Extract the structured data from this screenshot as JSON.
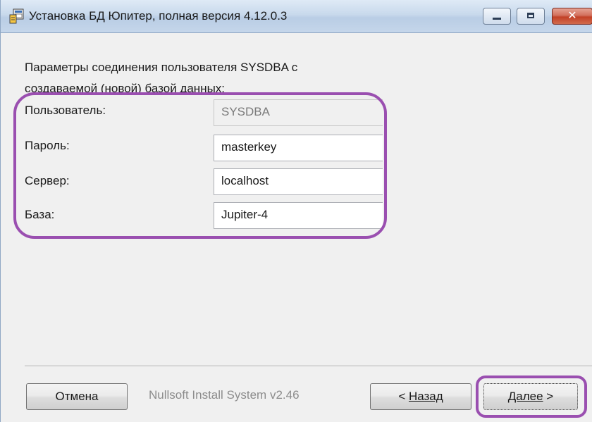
{
  "window": {
    "title": "Установка БД Юпитер, полная версия 4.12.0.3",
    "close_glyph": "✕"
  },
  "form": {
    "intro_line1": "Параметры соединения пользователя SYSDBA с",
    "intro_line2": "создаваемой (новой) базой данных:",
    "fields": [
      {
        "label": "Пользователь:",
        "value": "SYSDBA",
        "disabled": true
      },
      {
        "label": "Пароль:",
        "value": "masterkey",
        "disabled": false
      },
      {
        "label": "Сервер:",
        "value": "localhost",
        "disabled": false
      },
      {
        "label": "База:",
        "value": "Jupiter-4",
        "disabled": false
      }
    ]
  },
  "footer": {
    "cancel_label": "Отмена",
    "branding": "Nullsoft Install System v2.46",
    "back_prefix": "< ",
    "back_label": "Назад",
    "next_label": "Далее",
    "next_suffix": " >"
  },
  "colors": {
    "highlight": "#9a4fb0"
  },
  "icons": {
    "app": "installer-icon",
    "minimize": "minimize-icon",
    "maximize": "maximize-icon",
    "close": "close-icon"
  }
}
